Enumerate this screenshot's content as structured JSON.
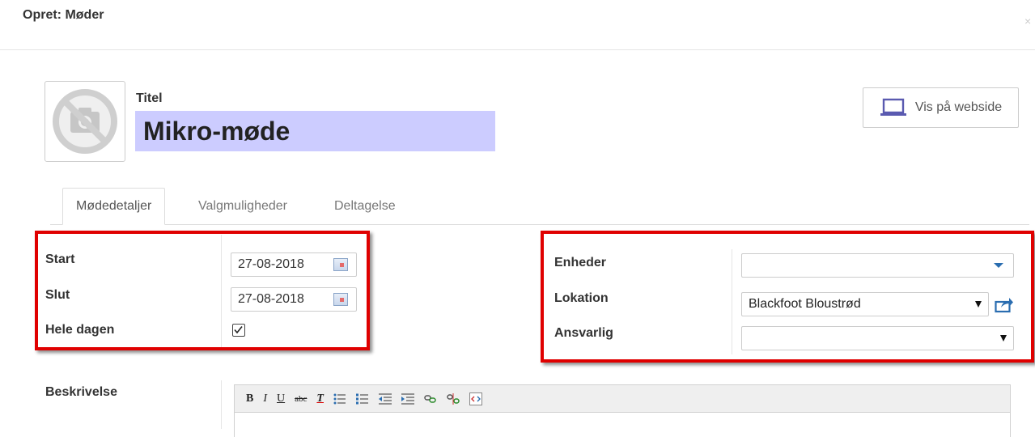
{
  "modal": {
    "title": "Opret: Møder",
    "close": "×"
  },
  "record": {
    "title_label": "Titel",
    "title_value": "Mikro-møde",
    "website_button": "Vis på webside"
  },
  "tabs": [
    {
      "label": "Mødedetaljer",
      "active": true
    },
    {
      "label": "Valgmuligheder",
      "active": false
    },
    {
      "label": "Deltagelse",
      "active": false
    }
  ],
  "left_group": {
    "start_label": "Start",
    "start_value": "27-08-2018",
    "end_label": "Slut",
    "end_value": "27-08-2018",
    "allday_label": "Hele dagen",
    "allday_checked": true
  },
  "right_group": {
    "units_label": "Enheder",
    "units_value": "",
    "location_label": "Lokation",
    "location_value": "Blackfoot Bloustrød",
    "responsible_label": "Ansvarlig",
    "responsible_value": ""
  },
  "description": {
    "label": "Beskrivelse",
    "toolbar": {
      "bold": "B",
      "italic": "I",
      "underline": "U",
      "strikethrough": "abc",
      "clear_format": "T"
    }
  },
  "colors": {
    "highlight": "#e00000",
    "title_bg": "#ccccff",
    "accent": "#2a6db0"
  }
}
